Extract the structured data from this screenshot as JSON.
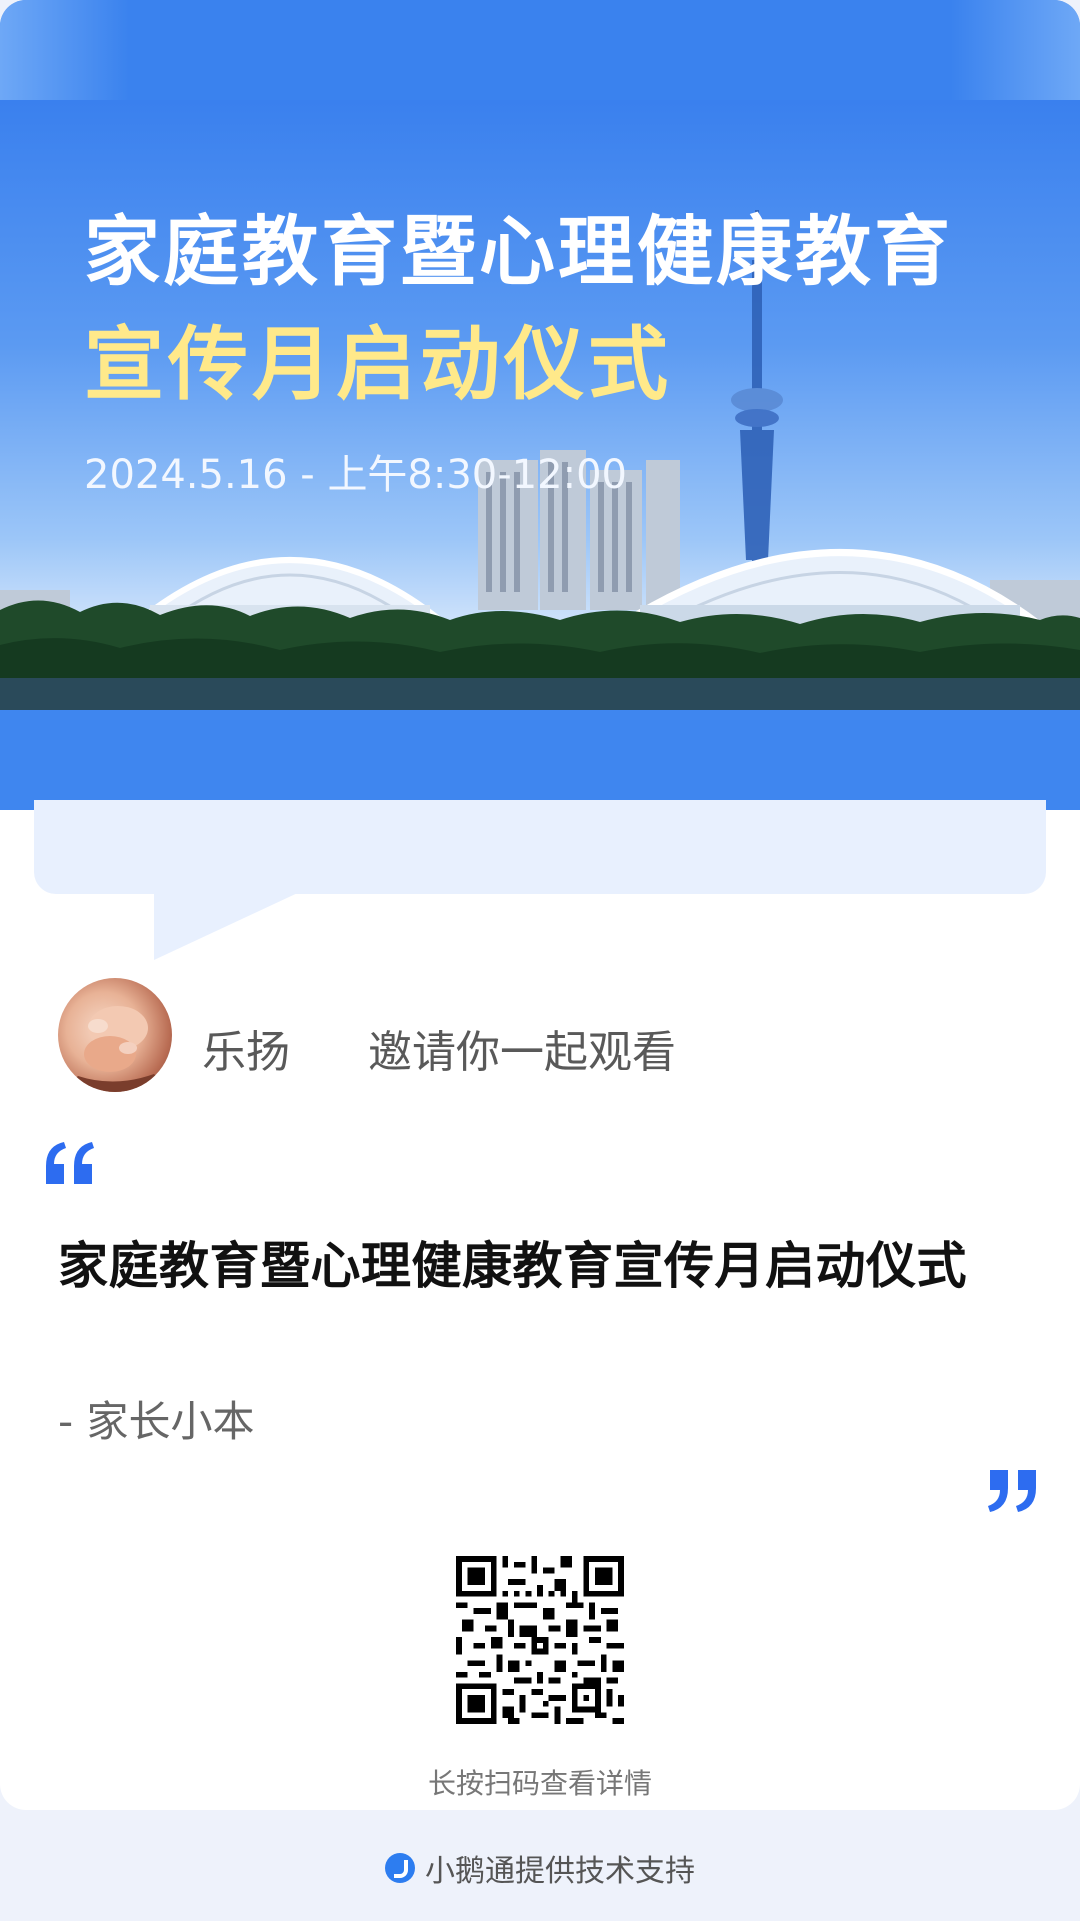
{
  "hero": {
    "title_line1": "家庭教育暨心理健康教育",
    "title_line2": "宣传月启动仪式",
    "date": "2024.5.16 - 上午8:30-12:00"
  },
  "invite": {
    "avatar": "avatar-baby-hands-photo",
    "name": "乐扬",
    "text": "邀请你一起观看"
  },
  "quote": {
    "title": "家庭教育暨心理健康教育宣传月启动仪式",
    "author": "- 家长小本"
  },
  "qr": {
    "caption": "长按扫码查看详情"
  },
  "footer": {
    "logo_icon": "xiaoe-logo-icon",
    "text": "小鹅通提供技术支持"
  },
  "colors": {
    "accent": "#2d6cf0",
    "hero_blue": "#3f86ef",
    "title_yellow": "#ffe98a",
    "bubble": "#e8f0fe",
    "page_bg": "#eef2fb"
  }
}
